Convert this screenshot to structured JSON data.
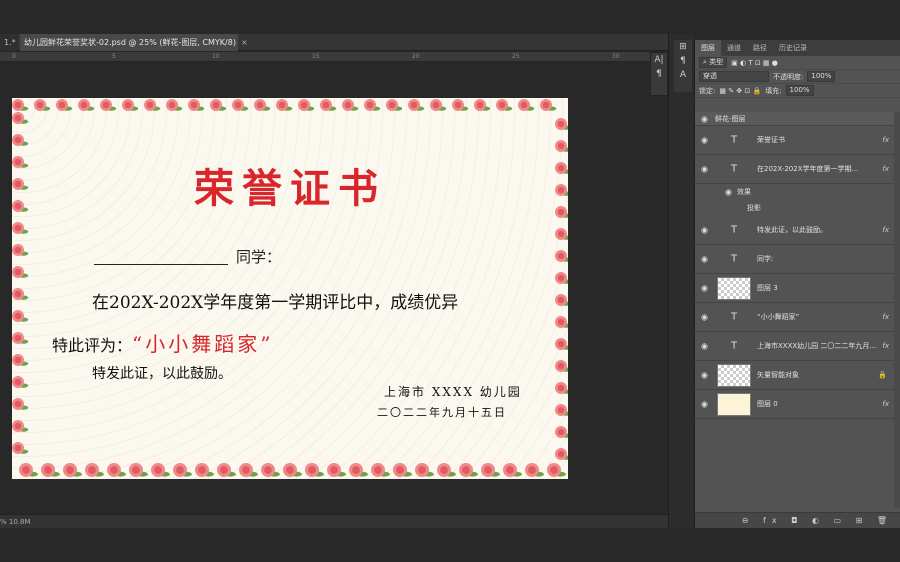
{
  "tabs": {
    "first": "1.*",
    "doc": "幼儿园鲜花荣誉奖状-02.psd @ 25% (鲜花-图层, CMYK/8)",
    "close": "×"
  },
  "ruler": [
    "0",
    "5",
    "10",
    "15",
    "20",
    "25",
    "30"
  ],
  "certificate": {
    "title": "荣誉证书",
    "tongxue": "同学：",
    "line1": "在202X-202X学年度第一学期评比中，成绩优异",
    "line2_prefix": "特此评为：",
    "award": "“小小舞蹈家”",
    "line3": "特发此证，以此鼓励。",
    "sig1": "上海市 XXXX 幼儿园",
    "sig2": "二〇二二年九月十五日"
  },
  "status": "%  10.8M",
  "mini_tools": [
    "A|",
    "¶"
  ],
  "mini_tools2": [
    "⊞",
    "¶",
    "A"
  ],
  "panel": {
    "tabs": [
      "图层",
      "通道",
      "路径",
      "历史记录"
    ],
    "filter_kind": "⌕ 类型",
    "blend_mode": "穿透",
    "opacity_label": "不透明度:",
    "opacity": "100%",
    "lock_label": "锁定:",
    "fill_label": "填充:",
    "fill": "100%",
    "footer": "⊖ fx ◘ ◐ ▭ ⊞ 🗑"
  },
  "layers": [
    {
      "type": "group",
      "name": "鲜花-图层"
    },
    {
      "type": "text",
      "name": "荣誉证书",
      "fx": "fx"
    },
    {
      "type": "text",
      "name": "在202X-202X学年度第一学期...",
      "fx": "fx"
    },
    {
      "type": "effects",
      "name": "效果"
    },
    {
      "type": "effects2",
      "name": "投影"
    },
    {
      "type": "text",
      "name": "特发此证，以此鼓励。",
      "fx": "fx"
    },
    {
      "type": "text",
      "name": "同学:"
    },
    {
      "type": "pixel",
      "name": "图层 3"
    },
    {
      "type": "text",
      "name": "“小小舞蹈家”",
      "fx": "fx"
    },
    {
      "type": "text",
      "name": "上海市XXXX幼儿园 二〇二二年九月...",
      "fx": "fx"
    },
    {
      "type": "smart",
      "name": "矢量智能对象",
      "lock": "🔒"
    },
    {
      "type": "fill",
      "name": "图层 0",
      "fx": "fx"
    }
  ]
}
